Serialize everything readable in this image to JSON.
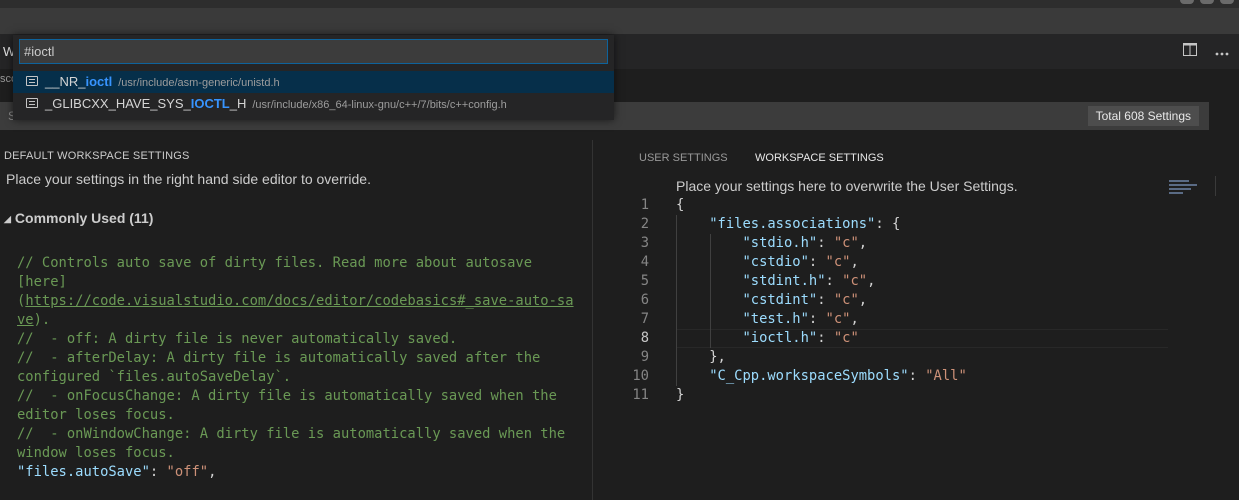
{
  "window": {
    "tab_stub": "W",
    "breadcrumb_stub": "sco"
  },
  "quick_open": {
    "input_value": "#ioctl",
    "items": [
      {
        "name_prefix": "__NR_",
        "name_match": "ioctl",
        "name_suffix": "",
        "path": "/usr/include/asm-generic/unistd.h",
        "selected": true
      },
      {
        "name_prefix": "_GLIBCXX_HAVE_SYS_",
        "name_match": "IOCTL",
        "name_suffix": "_H",
        "path": "/usr/include/x86_64-linux-gnu/c++/7/bits/c++config.h",
        "selected": false
      }
    ]
  },
  "search": {
    "placeholder": "S",
    "total_label": "Total 608 Settings"
  },
  "left_pane": {
    "header": "DEFAULT WORKSPACE SETTINGS",
    "description": "Place your settings in the right hand side editor to override.",
    "group_title": "Commonly Used (11)",
    "comment_lines": [
      "// Controls auto save of dirty files. Read more about autosave",
      "[here]",
      "(",
      "https://code.visualstudio.com/docs/editor/codebasics#_save-auto-sa",
      "ve",
      ").",
      "//  - off: A dirty file is never automatically saved.",
      "//  - afterDelay: A dirty file is automatically saved after the",
      "configured `files.autoSaveDelay`.",
      "//  - onFocusChange: A dirty file is automatically saved when the",
      "editor loses focus.",
      "//  - onWindowChange: A dirty file is automatically saved when the",
      "window loses focus."
    ],
    "setting_key": "\"files.autoSave\"",
    "setting_colon": ": ",
    "setting_value": "\"off\"",
    "setting_comma": ","
  },
  "right_pane": {
    "tabs": [
      "USER SETTINGS",
      "WORKSPACE SETTINGS"
    ],
    "description": "Place your settings here to overwrite the User Settings.",
    "line_numbers": [
      "1",
      "2",
      "3",
      "4",
      "5",
      "6",
      "7",
      "8",
      "9",
      "10",
      "11"
    ],
    "lines": [
      {
        "indent": "",
        "key": "",
        "value": "",
        "open": "{",
        "close": ""
      },
      {
        "indent": "    ",
        "key": "\"files.associations\"",
        "value": "",
        "open": ": {",
        "close": ""
      },
      {
        "indent": "        ",
        "key": "\"stdio.h\"",
        "value": "\"c\"",
        "open": "",
        "close": ","
      },
      {
        "indent": "        ",
        "key": "\"cstdio\"",
        "value": "\"c\"",
        "open": "",
        "close": ","
      },
      {
        "indent": "        ",
        "key": "\"stdint.h\"",
        "value": "\"c\"",
        "open": "",
        "close": ","
      },
      {
        "indent": "        ",
        "key": "\"cstdint\"",
        "value": "\"c\"",
        "open": "",
        "close": ","
      },
      {
        "indent": "        ",
        "key": "\"test.h\"",
        "value": "\"c\"",
        "open": "",
        "close": ","
      },
      {
        "indent": "        ",
        "key": "\"ioctl.h\"",
        "value": "\"c\"",
        "open": "",
        "close": ""
      },
      {
        "indent": "    ",
        "key": "",
        "value": "",
        "open": "},",
        "close": ""
      },
      {
        "indent": "    ",
        "key": "\"C_Cpp.workspaceSymbols\"",
        "value": "\"All\"",
        "open": "",
        "close": ""
      },
      {
        "indent": "",
        "key": "",
        "value": "",
        "open": "}",
        "close": ""
      }
    ],
    "current_line_index": 7
  },
  "colors": {
    "comment": "#6a9955",
    "json_key": "#9cdcfe",
    "json_string": "#ce9178",
    "match_highlight": "#3794ff",
    "selection": "#062f4a"
  }
}
